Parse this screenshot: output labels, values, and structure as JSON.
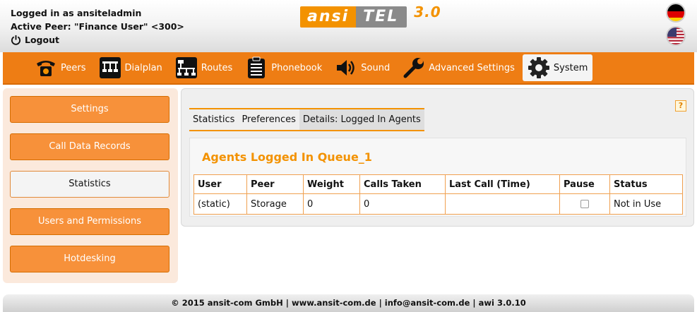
{
  "header": {
    "logged_in": "Logged in as ansiteladmin",
    "active_peer": "Active Peer: \"Finance User\" <300>",
    "logout": "Logout",
    "logo": {
      "ansi": "ansi",
      "tel": "TEL",
      "version": "3.0"
    }
  },
  "nav": {
    "items": [
      {
        "label": "Peers",
        "icon": "phone-icon"
      },
      {
        "label": "Dialplan",
        "icon": "dialplan-icon"
      },
      {
        "label": "Routes",
        "icon": "routes-icon"
      },
      {
        "label": "Phonebook",
        "icon": "phonebook-icon"
      },
      {
        "label": "Sound",
        "icon": "speaker-icon"
      },
      {
        "label": "Advanced Settings",
        "icon": "wrench-icon"
      },
      {
        "label": "System",
        "icon": "gear-icon"
      }
    ],
    "active": "System"
  },
  "sidebar": {
    "items": [
      {
        "label": "Settings"
      },
      {
        "label": "Call Data Records"
      },
      {
        "label": "Statistics"
      },
      {
        "label": "Users and Permissions"
      },
      {
        "label": "Hotdesking"
      }
    ],
    "active": "Statistics"
  },
  "tabs": [
    {
      "label": "Statistics"
    },
    {
      "label": "Preferences"
    },
    {
      "label": "Details: Logged In Agents"
    }
  ],
  "help": "?",
  "queue_title": "Agents Logged In Queue_1",
  "table": {
    "headers": [
      "User",
      "Peer",
      "Weight",
      "Calls Taken",
      "Last Call (Time)",
      "Pause",
      "Status"
    ],
    "rows": [
      {
        "user": "(static)",
        "peer": "Storage",
        "weight": "0",
        "calls_taken": "0",
        "last_call": "",
        "pause": false,
        "status": "Not in Use"
      }
    ]
  },
  "footer": "© 2015 ansit-com GmbH | www.ansit-com.de | info@ansit-com.de | awi 3.0.10",
  "colors": {
    "accent": "#ee7d14",
    "nav_bg": "#ee7d14",
    "sidebar_btn": "#f7913a",
    "title": "#f39200"
  }
}
